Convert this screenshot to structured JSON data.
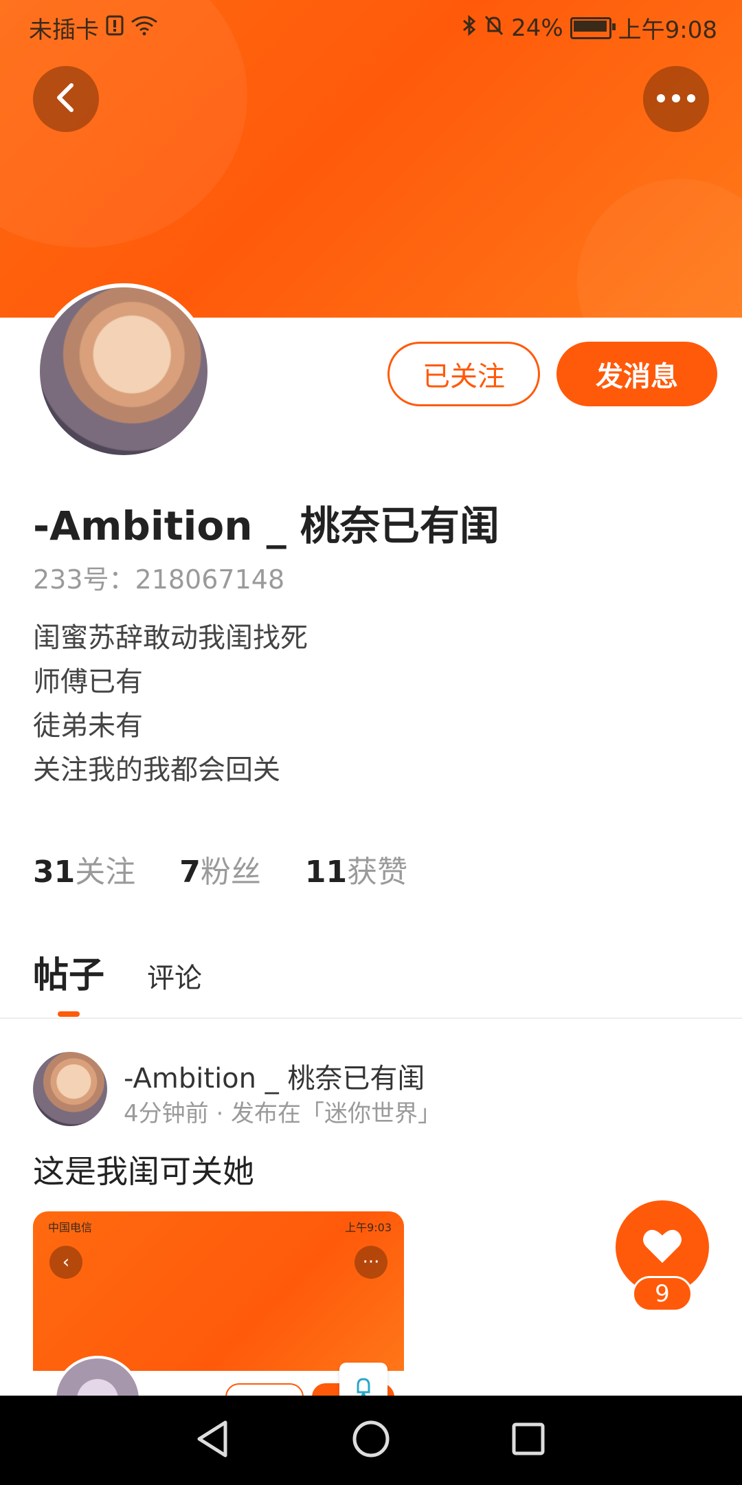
{
  "status_bar": {
    "carrier": "未插卡",
    "battery_percent": "24%",
    "time": "上午9:08",
    "battery_level": 0.24
  },
  "header": {
    "back_icon": "chevron-left-icon",
    "more_icon": "more-dots-icon",
    "brand_color": "#ff5a0a"
  },
  "profile": {
    "follow_button_label": "已关注",
    "message_button_label": "发消息",
    "username": "-Ambition _ 桃奈已有闺",
    "uid": "233号：218067148",
    "bio": [
      "闺蜜苏辞敢动我闺找死",
      "师傅已有",
      "徒弟未有",
      "关注我的我都会回关"
    ],
    "stats": [
      {
        "num": "31",
        "label": "关注"
      },
      {
        "num": "7",
        "label": "粉丝"
      },
      {
        "num": "11",
        "label": "获赞"
      }
    ]
  },
  "tabs": [
    {
      "label": "帖子",
      "active": true
    },
    {
      "label": "评论",
      "active": false
    }
  ],
  "post": {
    "author": "-Ambition _ 桃奈已有闺",
    "meta": "4分钟前 · 发布在「迷你世界」",
    "text": "这是我闺可关她",
    "image": {
      "status_left": "中国电信",
      "status_right": "上午9:03"
    },
    "like_count": "9"
  }
}
